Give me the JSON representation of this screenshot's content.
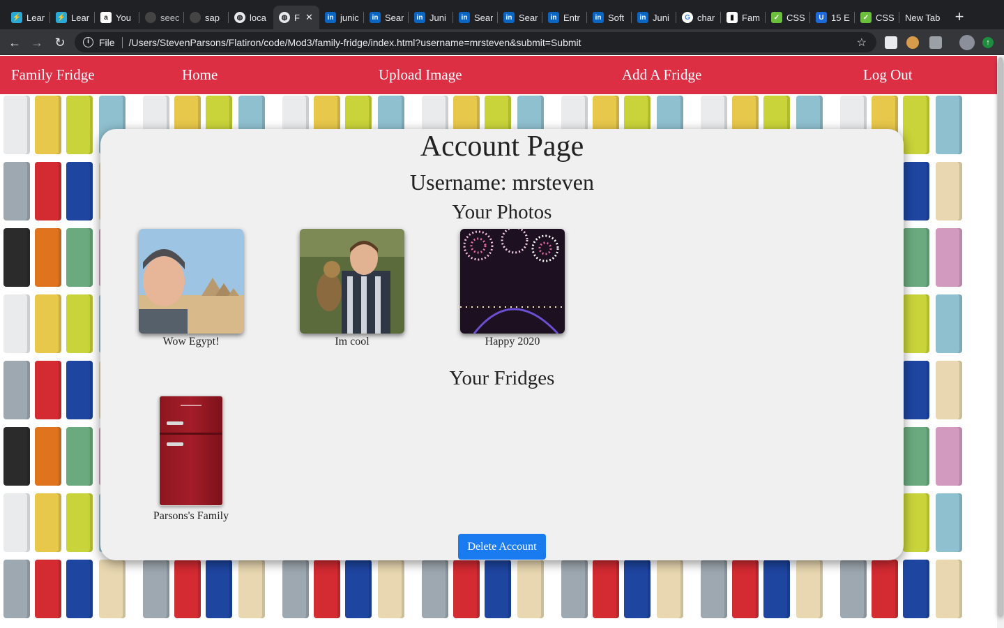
{
  "browser": {
    "tabs": [
      {
        "title": "Lear",
        "icon": "learn-icon",
        "color": "#2aa9d6"
      },
      {
        "title": "Lear",
        "icon": "learn-icon",
        "color": "#2aa9d6"
      },
      {
        "title": "You",
        "icon": "amazon-icon",
        "color": "#ffffff"
      },
      {
        "title": "seec",
        "icon": "github-icon",
        "color": "#444"
      },
      {
        "title": "sap",
        "icon": "github-icon",
        "color": "#444"
      },
      {
        "title": "loca",
        "icon": "globe-icon",
        "color": "#bbb"
      },
      {
        "title": "F",
        "icon": "globe-icon",
        "color": "#bbb",
        "active": true
      },
      {
        "title": "junic",
        "icon": "linkedin-icon",
        "color": "#0a66c2"
      },
      {
        "title": "Sear",
        "icon": "linkedin-icon",
        "color": "#0a66c2"
      },
      {
        "title": "Juni",
        "icon": "linkedin-icon",
        "color": "#0a66c2"
      },
      {
        "title": "Sear",
        "icon": "linkedin-icon",
        "color": "#0a66c2"
      },
      {
        "title": "Sear",
        "icon": "linkedin-icon",
        "color": "#0a66c2"
      },
      {
        "title": "Entr",
        "icon": "linkedin-icon",
        "color": "#0a66c2"
      },
      {
        "title": "Soft",
        "icon": "linkedin-icon",
        "color": "#0a66c2"
      },
      {
        "title": "Juni",
        "icon": "linkedin-icon",
        "color": "#0a66c2"
      },
      {
        "title": "char",
        "icon": "google-icon",
        "color": "#ffffff"
      },
      {
        "title": "Fam",
        "icon": "trello-icon",
        "color": "#ffffff"
      },
      {
        "title": "CSS",
        "icon": "css-icon",
        "color": "#6bbf3c"
      },
      {
        "title": "15 E",
        "icon": "u-icon",
        "color": "#1b6ad8"
      },
      {
        "title": "CSS",
        "icon": "css-icon",
        "color": "#6bbf3c"
      },
      {
        "title": "New Tab",
        "icon": "",
        "color": ""
      }
    ],
    "omnibox": {
      "scheme_label": "File",
      "url": "/Users/StevenParsons/Flatiron/code/Mod3/family-fridge/index.html?username=mrsteven&submit=Submit"
    }
  },
  "navbar": {
    "brand": "Family Fridge",
    "home": "Home",
    "upload": "Upload Image",
    "add_fridge": "Add A Fridge",
    "logout": "Log Out",
    "color": "#dc2f44"
  },
  "account": {
    "title": "Account Page",
    "username_line": "Username: mrsteven",
    "photos_heading": "Your Photos",
    "photos": [
      {
        "caption": "Wow Egypt!"
      },
      {
        "caption": "Im cool"
      },
      {
        "caption": "Happy 2020"
      }
    ],
    "fridges_heading": "Your Fridges",
    "fridges": [
      {
        "caption": "Parsons's Family"
      }
    ],
    "delete_label": "Delete Account",
    "delete_color": "#1a7bf0"
  }
}
